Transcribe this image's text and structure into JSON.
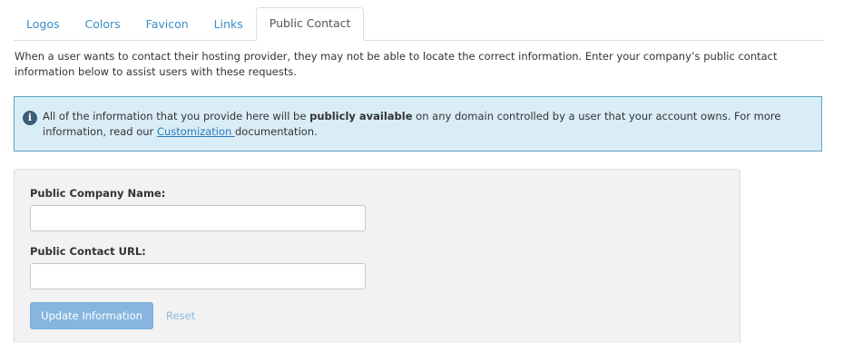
{
  "tabs": [
    {
      "label": "Logos",
      "active": false
    },
    {
      "label": "Colors",
      "active": false
    },
    {
      "label": "Favicon",
      "active": false
    },
    {
      "label": "Links",
      "active": false
    },
    {
      "label": "Public Contact",
      "active": true
    }
  ],
  "description": "When a user wants to contact their hosting provider, they may not be able to locate the correct information. Enter your company’s public contact information below to assist users with these requests.",
  "alert": {
    "icon": "info-icon",
    "icon_glyph": "i",
    "text_before": "All of the information that you provide here will be ",
    "bold_text": "publicly available",
    "text_middle": " on any domain controlled by a user that your account owns. For more information, read our ",
    "link_text": "Customization ",
    "text_after": " documentation.",
    "background_color": "#d9edf7",
    "border_color": "#5fa2c9"
  },
  "form": {
    "company_name_label": "Public Company Name:",
    "company_name_value": "",
    "contact_url_label": "Public Contact URL:",
    "contact_url_value": "",
    "update_button_label": "Update Information",
    "reset_label": "Reset"
  },
  "colors": {
    "link": "#3a8fc9",
    "button": "#86b6de"
  }
}
